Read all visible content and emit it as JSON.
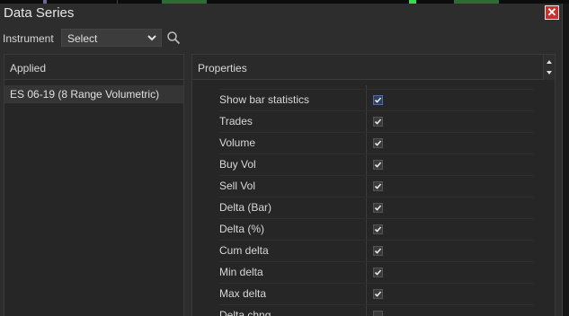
{
  "dialog": {
    "title": "Data Series",
    "close_label": "✕"
  },
  "instrument": {
    "label": "Instrument",
    "selected": "Select"
  },
  "applied": {
    "header": "Applied",
    "items": [
      {
        "label": "ES 06-19 (8 Range Volumetric)"
      }
    ]
  },
  "properties": {
    "header": "Properties",
    "rows": [
      {
        "name": "Show bar statistics",
        "checked": true,
        "focused": true
      },
      {
        "name": "Trades",
        "checked": true
      },
      {
        "name": "Volume",
        "checked": true
      },
      {
        "name": "Buy Vol",
        "checked": true
      },
      {
        "name": "Sell Vol",
        "checked": true
      },
      {
        "name": "Delta (Bar)",
        "checked": true
      },
      {
        "name": "Delta (%)",
        "checked": true
      },
      {
        "name": "Cum delta",
        "checked": true
      },
      {
        "name": "Min delta",
        "checked": true
      },
      {
        "name": "Max delta",
        "checked": true
      },
      {
        "name": "Delta chng",
        "checked": false
      }
    ]
  },
  "colors": {
    "accent": "#c9302c",
    "focus": "#4a6fa0",
    "chart_green": "#2f6b34",
    "chart_bright_green": "#2ee04a"
  }
}
